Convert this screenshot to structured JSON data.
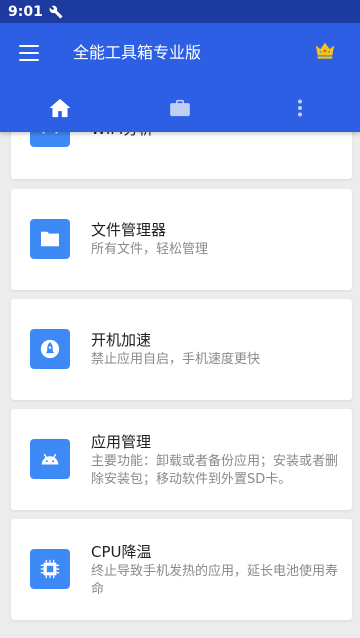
{
  "status_bar": {
    "time": "9:01",
    "icon": "wrench-icon"
  },
  "app_bar": {
    "title": "全能工具箱专业版",
    "menu_icon": "hamburger-menu-icon",
    "vip_icon": "crown-icon",
    "tabs": [
      {
        "icon": "home-icon",
        "active": true
      },
      {
        "icon": "briefcase-icon",
        "active": false
      },
      {
        "icon": "more-vertical-icon",
        "active": false
      }
    ]
  },
  "colors": {
    "status_bar": "#1d3a9e",
    "app_bar": "#2c5fe3",
    "icon_tile": "#3d8af7",
    "background": "#ececec",
    "crown": "#f5c518"
  },
  "cards": [
    {
      "title": "WIFI分析",
      "description": "",
      "icon": "wifi-network-icon"
    },
    {
      "title": "文件管理器",
      "description": "所有文件，轻松管理",
      "icon": "folder-icon"
    },
    {
      "title": "开机加速",
      "description": "禁止应用自启，手机速度更快",
      "icon": "rocket-icon"
    },
    {
      "title": "应用管理",
      "description": "主要功能：卸载或者备份应用；安装或者删除安装包；移动软件到外置SD卡。",
      "icon": "android-icon"
    },
    {
      "title": "CPU降温",
      "description": "终止导致手机发热的应用，延长电池使用寿命",
      "icon": "cpu-chip-icon"
    }
  ]
}
